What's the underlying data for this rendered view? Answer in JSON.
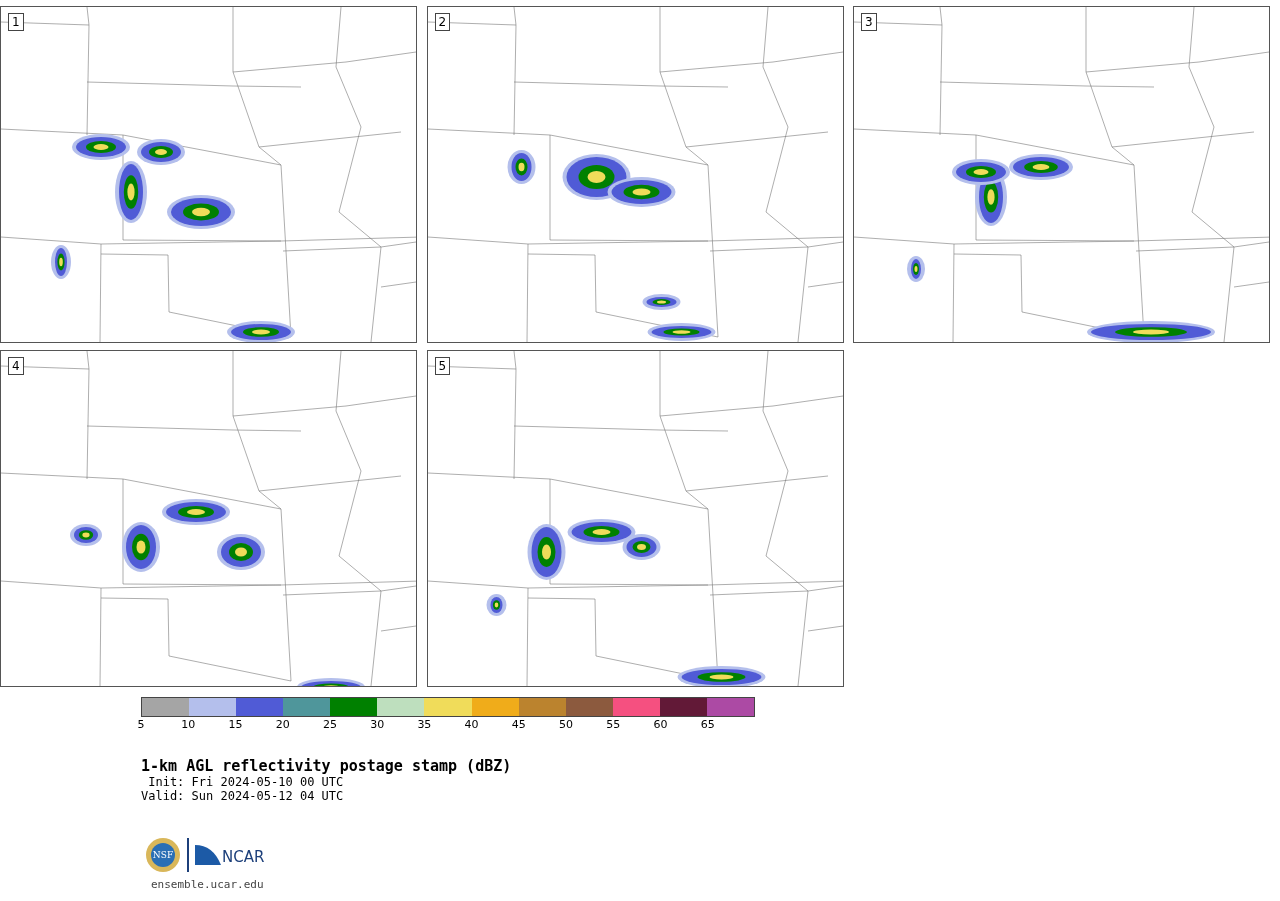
{
  "panels": [
    {
      "label": "1"
    },
    {
      "label": "2"
    },
    {
      "label": "3"
    },
    {
      "label": "4"
    },
    {
      "label": "5"
    }
  ],
  "colorbar": {
    "segments": [
      {
        "color": "#a5a5a5"
      },
      {
        "color": "#b4bfec"
      },
      {
        "color": "#505bd6"
      },
      {
        "color": "#4f969b"
      },
      {
        "color": "#008000"
      },
      {
        "color": "#bedfbe"
      },
      {
        "color": "#f0dc5a"
      },
      {
        "color": "#f0ac1a"
      },
      {
        "color": "#bb832e"
      },
      {
        "color": "#8c5a3e"
      },
      {
        "color": "#f55080"
      },
      {
        "color": "#621937"
      },
      {
        "color": "#ac4aa4"
      }
    ],
    "ticks": [
      "5",
      "10",
      "15",
      "20",
      "25",
      "30",
      "35",
      "40",
      "45",
      "50",
      "55",
      "60",
      "65"
    ]
  },
  "title": "1-km AGL reflectivity postage stamp (dBZ)",
  "init": " Init: Fri 2024-05-10 00 UTC",
  "valid": "Valid: Sun 2024-05-12 04 UTC",
  "url": "ensemble.ucar.edu",
  "logos": {
    "seal_text": "NSF",
    "wordmark": "NCAR"
  }
}
